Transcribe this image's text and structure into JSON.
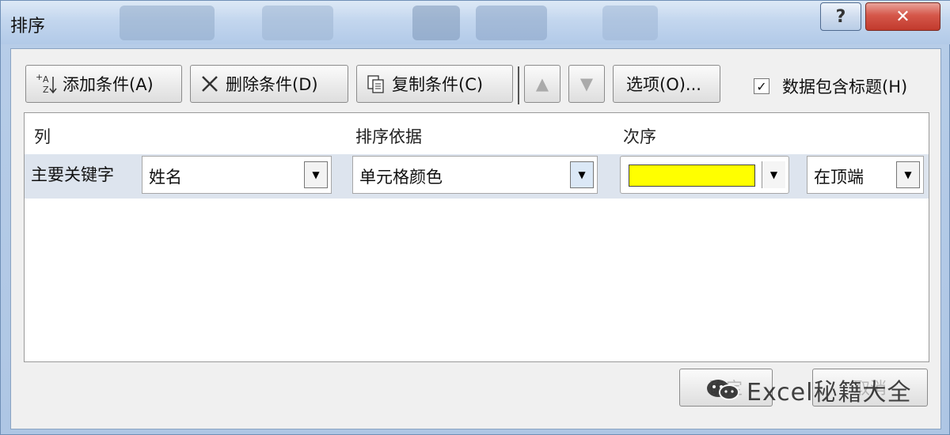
{
  "window": {
    "title": "排序",
    "help_glyph": "?",
    "close_glyph": "✕"
  },
  "toolbar": {
    "add_label": "添加条件(A)",
    "delete_label": "删除条件(D)",
    "copy_label": "复制条件(C)",
    "move_up_glyph": "▲",
    "move_down_glyph": "▼",
    "options_label": "选项(O)...",
    "header_checkbox_label": "数据包含标题(H)",
    "header_checkbox_checked": true
  },
  "grid": {
    "headers": {
      "column": "列",
      "sort_on": "排序依据",
      "order": "次序"
    },
    "rows": [
      {
        "label": "主要关键字",
        "column_value": "姓名",
        "sort_on_value": "单元格颜色",
        "order_color": "#ffff00",
        "order_position": "在顶端"
      }
    ]
  },
  "footer": {
    "ok_label": "确定",
    "cancel_label": "取消"
  },
  "watermark": {
    "text": "Excel秘籍大全"
  },
  "colors": {
    "close_red": "#c13a2d",
    "row_highlight": "#dde4ee",
    "swatch_yellow": "#ffff00"
  }
}
